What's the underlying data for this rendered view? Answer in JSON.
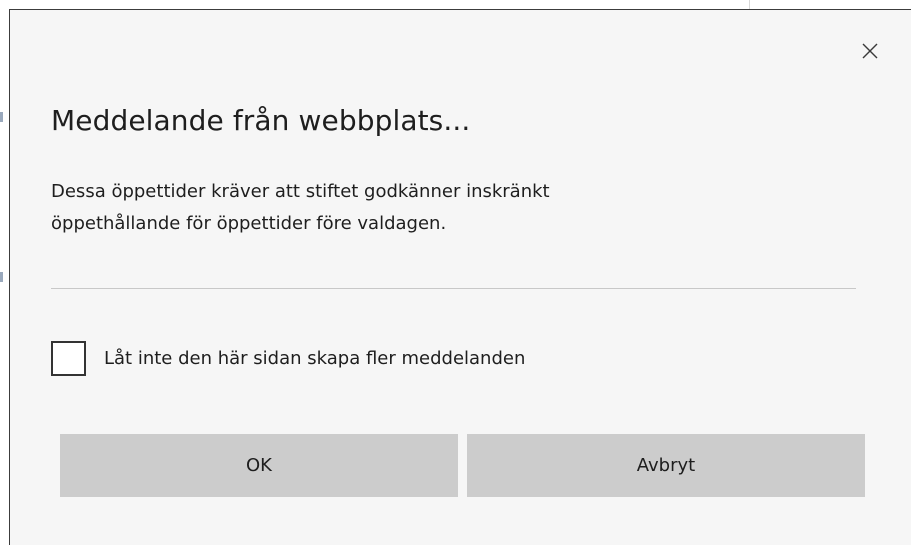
{
  "dialog": {
    "title": "Meddelande från webbplats...",
    "message_line1": "Dessa öppettider kräver att stiftet godkänner inskränkt",
    "message_line2": "öppethållande för öppettider före valdagen.",
    "close_icon": "close-icon",
    "suppress_checkbox": {
      "label": "Låt inte den här sidan skapa fler meddelanden",
      "checked": false
    },
    "buttons": {
      "ok_label": "OK",
      "cancel_label": "Avbryt"
    }
  },
  "colors": {
    "dialog_background": "#f6f6f6",
    "button_background": "#cccccc",
    "text": "#1e1e1e",
    "divider": "#c8c8c8"
  }
}
